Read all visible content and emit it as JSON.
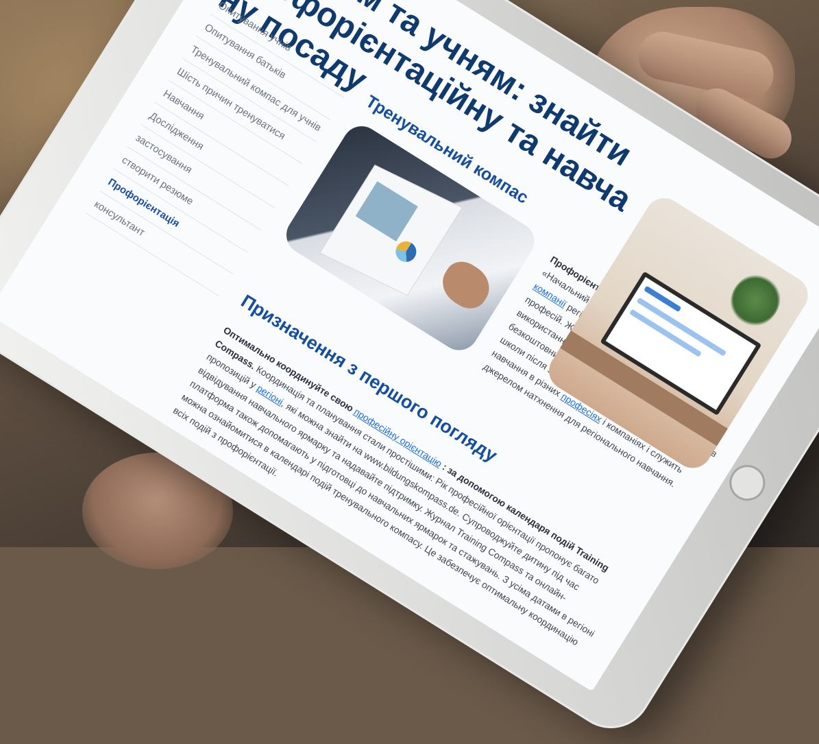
{
  "page": {
    "title_line1": "Батькам та учням: знайти профорієнтаційну та навча",
    "title_line2": "ну посаду"
  },
  "nav": {
    "items": [
      {
        "label": "Опитування учнів",
        "active": false
      },
      {
        "label": "Опитування батьків",
        "active": false
      },
      {
        "label": "Тренувальний компас для учнів",
        "active": false
      },
      {
        "label": "Шість причин тренуватися",
        "active": false
      },
      {
        "label": "Навчання",
        "active": false
      },
      {
        "label": "Дослідження",
        "active": false
      },
      {
        "label": "застосування",
        "active": false
      },
      {
        "label": "створити резюме",
        "active": false
      },
      {
        "label": "Профорієнтація",
        "active": true
      },
      {
        "label": "консультант",
        "active": false
      }
    ]
  },
  "section1": {
    "title": "Тренувальний компас",
    "text_bold": "Профорієнтація потребує цілісної основи.",
    "text_a": " Журнал «Начальний компас» описує професії та називає ",
    "link1": "компанії",
    "text_b": " регіону, які займаються підготовкою цих професій. Журнал ідеально підходить для порад і використання в навчанні. Training Compass — це безкоштовний щорічний журнал, який доставляється в школи після замовлення. Він описує можливості навчання в різних ",
    "link2": "професіях",
    "text_c": " і компаніях і служить джерелом натхнення для регіонального навчання."
  },
  "section2": {
    "title": "Призначення з першого погляду",
    "text_bold1": "Оптимально координуйте свою ",
    "link1": "професійну орієнтацію",
    "text_bold2": " : за допомогою календаря подій Training Compass.",
    "text_a": " Координація та планування стали простішими: Рік професійної орієнтації пропонує багато пропозицій у ",
    "link2": "регіоні",
    "text_b": ", які можна знайти на www.bildungskompass.de. Супроводжуйте дитину під час відвідування навчального ярмарку та надавайте підтримку. Журнал Training Compass та онлайн-платформа також допомагають у підготовці до навчальних ярмарок та стажувань. З усіма датами в регіоні можна ознайомитися в календарі подій тренувального компасу. Це забезпечує оптимальну координацію всіх подій з профорієнтації."
  },
  "colors": {
    "title": "#0f3a6e",
    "heading": "#154e9a",
    "link": "#1a6fd1",
    "tablet_frame": "#e4e4e3",
    "screen_bg": "#fafbfd"
  },
  "icons": {
    "home_button": "home-button-icon"
  }
}
